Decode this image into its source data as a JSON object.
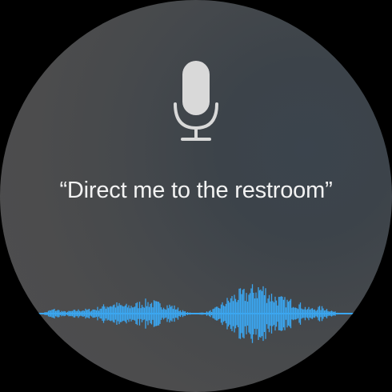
{
  "assistant": {
    "transcript": "“Direct me to the restroom”",
    "status_icon": "microphone-icon",
    "waveform_icon": "audio-waveform",
    "colors": {
      "background": "#4a4b4c",
      "text": "#f2f2f2",
      "mic": "#d9d9d9",
      "waveform": "#3ba6f0"
    }
  }
}
